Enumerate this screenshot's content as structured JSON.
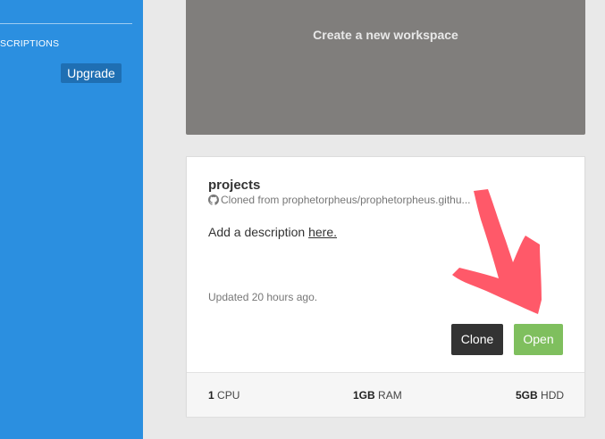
{
  "sidebar": {
    "section_label": "SCRIPTIONS",
    "upgrade_label": "Upgrade"
  },
  "new_workspace": {
    "label": "Create a new workspace"
  },
  "workspace": {
    "name": "projects",
    "source_text": "Cloned from prophetorpheus/prophetorpheus.githu...",
    "description_prefix": "Add a description ",
    "description_link": "here.",
    "updated": "Updated 20 hours ago.",
    "clone_label": "Clone",
    "open_label": "Open",
    "specs": {
      "cpu_value": "1",
      "cpu_unit": "CPU",
      "ram_value": "1GB",
      "ram_unit": "RAM",
      "hdd_value": "5GB",
      "hdd_unit": "HDD"
    }
  },
  "colors": {
    "sidebar": "#2b8fe0",
    "upgrade_button": "#1f6fb3",
    "new_workspace_card": "#807e7c",
    "clone_button": "#333333",
    "open_button": "#7fbf5e",
    "annotation_arrow": "#ff4b5c"
  },
  "icons": {
    "plus_circle": "plus-circle-icon",
    "github": "github-icon",
    "annotation": "red-arrow-annotation"
  }
}
